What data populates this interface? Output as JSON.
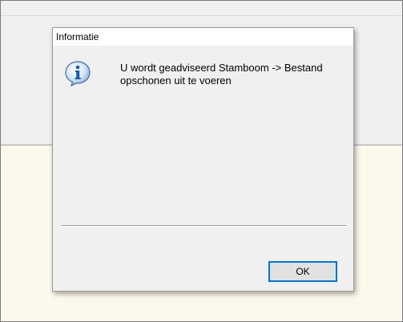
{
  "dialog": {
    "title": "Informatie",
    "icon": "info-icon",
    "message_line1": "U wordt geadviseerd Stamboom -> Bestand",
    "message_line2": "opschonen uit te voeren",
    "ok_label": "OK"
  },
  "colors": {
    "dialog_bg": "#f0f0f0",
    "background": "#fdf8ec",
    "focus_border": "#0078d7",
    "icon_blue": "#1a5ea8"
  }
}
